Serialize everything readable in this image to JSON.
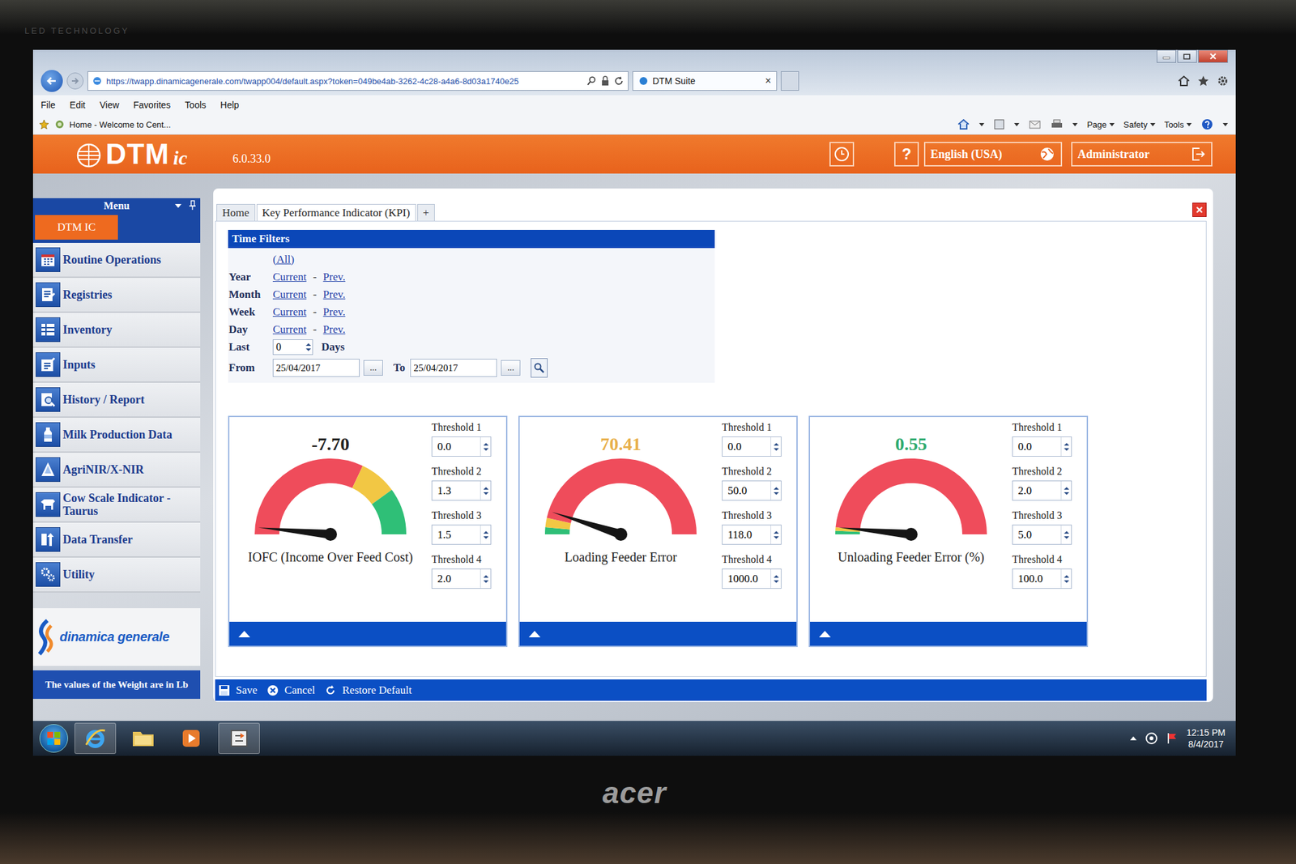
{
  "monitor": {
    "bezel_label": "LED TECHNOLOGY",
    "brand": "acer"
  },
  "browser": {
    "address": "https://twapp.dinamicagenerale.com/twapp004/default.aspx?token=049be4ab-3262-4c28-a4a6-8d03a1740e25",
    "tabs": [
      {
        "label": "DTM Suite",
        "selected": true
      }
    ],
    "tab_close": "×",
    "menu": [
      "File",
      "Edit",
      "View",
      "Favorites",
      "Tools",
      "Help"
    ],
    "favorite": "Home - Welcome to Cent...",
    "commands": [
      "Page",
      "Safety",
      "Tools"
    ]
  },
  "header": {
    "logo": "DTM",
    "logo_suffix": "ic",
    "version": "6.0.33.0",
    "help": "?",
    "language": "English (USA)",
    "user": "Administrator"
  },
  "sidebar": {
    "title": "Menu",
    "module": "DTM IC",
    "items": [
      {
        "label": "Routine Operations"
      },
      {
        "label": "Registries"
      },
      {
        "label": "Inventory"
      },
      {
        "label": "Inputs"
      },
      {
        "label": "History / Report"
      },
      {
        "label": "Milk Production Data"
      },
      {
        "label": "AgriNIR/X-NIR"
      },
      {
        "label": "Cow Scale Indicator - Taurus"
      },
      {
        "label": "Data Transfer"
      },
      {
        "label": "Utility"
      }
    ],
    "brand": "dinamica generale",
    "note": "The values of the Weight are in Lb"
  },
  "tabs": [
    {
      "label": "Home",
      "selected": false
    },
    {
      "label": "Key Performance Indicator (KPI)",
      "selected": true
    },
    {
      "label": "+",
      "selected": false
    }
  ],
  "time_filters": {
    "title": "Time Filters",
    "all": "(All)",
    "rows": [
      {
        "label": "Year",
        "current": "Current",
        "sep": "-",
        "prev": "Prev."
      },
      {
        "label": "Month",
        "current": "Current",
        "sep": "-",
        "prev": "Prev."
      },
      {
        "label": "Week",
        "current": "Current",
        "sep": "-",
        "prev": "Prev."
      },
      {
        "label": "Day",
        "current": "Current",
        "sep": "-",
        "prev": "Prev."
      }
    ],
    "last": {
      "label": "Last",
      "value": "0",
      "unit": "Days"
    },
    "from": {
      "label": "From",
      "value": "25/04/2017"
    },
    "to": {
      "label": "To",
      "value": "25/04/2017"
    },
    "picker": "..."
  },
  "gauges": [
    {
      "label": "IOFC (Income Over Feed Cost)",
      "value": "-7.70",
      "value_color": "#222222",
      "needle": 0.03,
      "segments": [
        {
          "color": "#ef4c5b",
          "level": 0.64
        },
        {
          "color": "#f2c744",
          "level": 0.8
        },
        {
          "color": "#2fbf77",
          "level": 1
        }
      ],
      "thresholds": [
        {
          "label": "Threshold 1",
          "value": "0.0"
        },
        {
          "label": "Threshold 2",
          "value": "1.3"
        },
        {
          "label": "Threshold 3",
          "value": "1.5"
        },
        {
          "label": "Threshold 4",
          "value": "2.0"
        }
      ]
    },
    {
      "label": "Loading Feeder Error",
      "value": "70.41",
      "value_color": "#e8b04b",
      "needle": 0.1,
      "segments": [
        {
          "color": "#2fbf77",
          "level": 0.03
        },
        {
          "color": "#f2c744",
          "level": 0.07
        },
        {
          "color": "#ef4c5b",
          "level": 1
        }
      ],
      "thresholds": [
        {
          "label": "Threshold 1",
          "value": "0.0"
        },
        {
          "label": "Threshold 2",
          "value": "50.0"
        },
        {
          "label": "Threshold 3",
          "value": "118.0"
        },
        {
          "label": "Threshold 4",
          "value": "1000.0"
        }
      ]
    },
    {
      "label": "Unloading Feeder Error (%)",
      "value": "0.55",
      "value_color": "#2eaa6e",
      "needle": 0.03,
      "segments": [
        {
          "color": "#2fbf77",
          "level": 0.015
        },
        {
          "color": "#f2c744",
          "level": 0.03
        },
        {
          "color": "#ef4c5b",
          "level": 1
        }
      ],
      "thresholds": [
        {
          "label": "Threshold 1",
          "value": "0.0"
        },
        {
          "label": "Threshold 2",
          "value": "2.0"
        },
        {
          "label": "Threshold 3",
          "value": "5.0"
        },
        {
          "label": "Threshold 4",
          "value": "100.0"
        }
      ]
    }
  ],
  "footer": [
    {
      "label": "Save"
    },
    {
      "label": "Cancel"
    },
    {
      "label": "Restore Default"
    }
  ],
  "taskbar": {
    "time": "12:15 PM",
    "date": "8/4/2017"
  }
}
